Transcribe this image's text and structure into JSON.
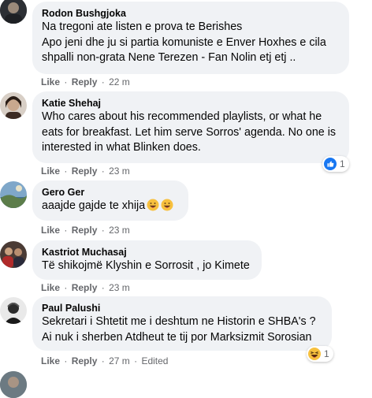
{
  "colors": {
    "bubble": "#f0f2f5",
    "meta": "#65676b",
    "like_blue": "#1877f2",
    "haha_yellow": "#f7c03e"
  },
  "comments": [
    {
      "author": "Rodon Bushgjoka",
      "text": "Na tregoni ate listen e prova te Berishes\nApo jeni dhe ju si partia komuniste e Enver Hoxhes e cila shpalli non-grata Nene Terezen - Fan Nolin etj etj ..",
      "like_label": "Like",
      "reply_label": "Reply",
      "time": "22 m"
    },
    {
      "author": "Katie Shehaj",
      "text": "Who cares about his recommended playlists, or what he eats for breakfast. Let him serve Sorros' agenda. No one is interested in what Blinken does.",
      "like_label": "Like",
      "reply_label": "Reply",
      "time": "23 m",
      "reaction": {
        "icon": "like-reaction-icon",
        "count": "1"
      }
    },
    {
      "author": "Gero Ger",
      "text": "aaajde gajde te xhija",
      "emojis": [
        "grinning-face-icon",
        "grinning-face-icon"
      ],
      "like_label": "Like",
      "reply_label": "Reply",
      "time": "23 m"
    },
    {
      "author": "Kastriot Muchasaj",
      "text": "Të shikojmë Klyshin e Sorrosit , jo Kimete",
      "like_label": "Like",
      "reply_label": "Reply",
      "time": "23 m"
    },
    {
      "author": "Paul Palushi",
      "text": "Sekretari i Shtetit me i deshtum ne Historin e SHBA's ?\nAi nuk i sherben Atdheut te tij por Marksizmit Sorosian",
      "like_label": "Like",
      "reply_label": "Reply",
      "time": "27 m",
      "edited": "Edited",
      "reaction": {
        "icon": "haha-reaction-icon",
        "count": "1"
      }
    }
  ]
}
